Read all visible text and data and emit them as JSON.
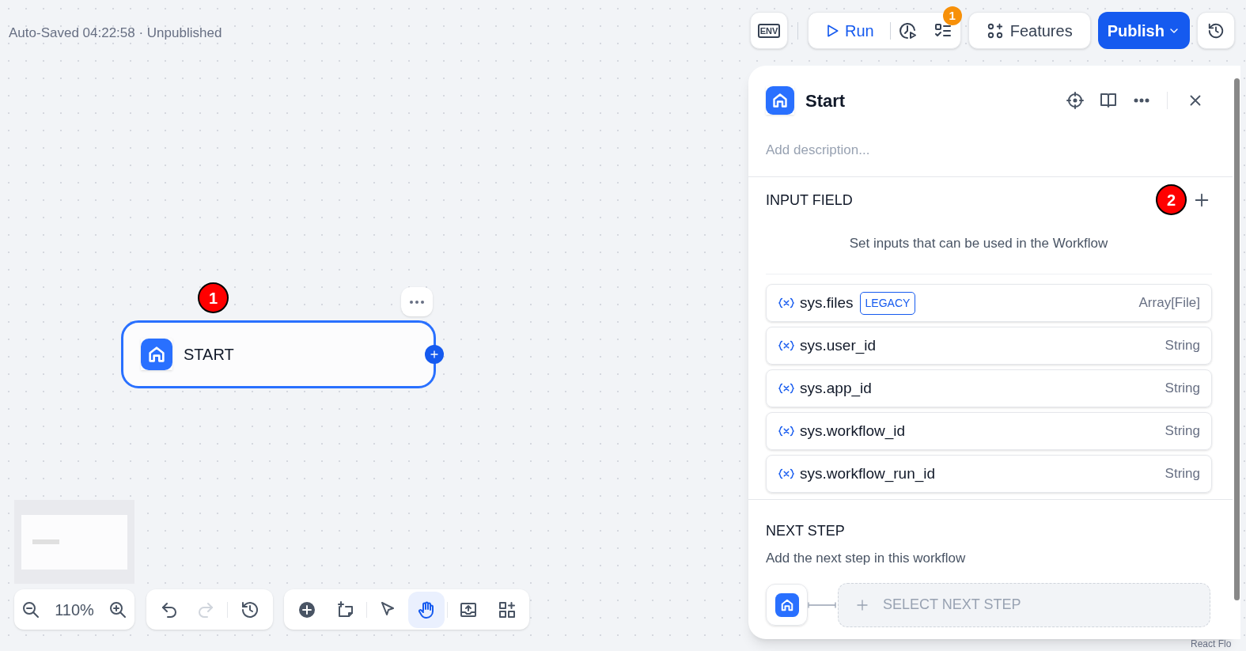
{
  "header": {
    "autosave": "Auto-Saved 04:22:58 · Unpublished"
  },
  "toolbar": {
    "env_label": "ENV",
    "run": "Run",
    "checklist_badge": "1",
    "features": "Features",
    "publish": "Publish"
  },
  "canvas": {
    "node": {
      "title": "START",
      "selected": true
    },
    "markers": [
      "1",
      "2"
    ],
    "attribution": "React Flo"
  },
  "zoom": {
    "reading": "110%"
  },
  "history_tools": [
    {
      "kind": "undo",
      "disabled": false
    },
    {
      "kind": "redo",
      "disabled": true
    },
    {
      "kind": "history",
      "disabled": false
    }
  ],
  "canvas_tools": [
    {
      "kind": "add",
      "selected": false
    },
    {
      "kind": "note",
      "selected": false
    },
    {
      "kind": "pointer",
      "selected": false
    },
    {
      "kind": "hand",
      "selected": true
    },
    {
      "kind": "export",
      "selected": false
    },
    {
      "kind": "organize",
      "selected": false
    }
  ],
  "panel": {
    "title": "Start",
    "description_placeholder": "Add description...",
    "input_field": {
      "heading": "INPUT FIELD",
      "hint": "Set inputs that can be used in the Workflow",
      "variables": [
        {
          "name": "sys.files",
          "tag": "LEGACY",
          "type": "Array[File]"
        },
        {
          "name": "sys.user_id",
          "type": "String"
        },
        {
          "name": "sys.app_id",
          "type": "String"
        },
        {
          "name": "sys.workflow_id",
          "type": "String"
        },
        {
          "name": "sys.workflow_run_id",
          "type": "String"
        }
      ]
    },
    "next_step": {
      "heading": "NEXT STEP",
      "hint": "Add the next step in this workflow",
      "button": "SELECT NEXT STEP"
    }
  }
}
